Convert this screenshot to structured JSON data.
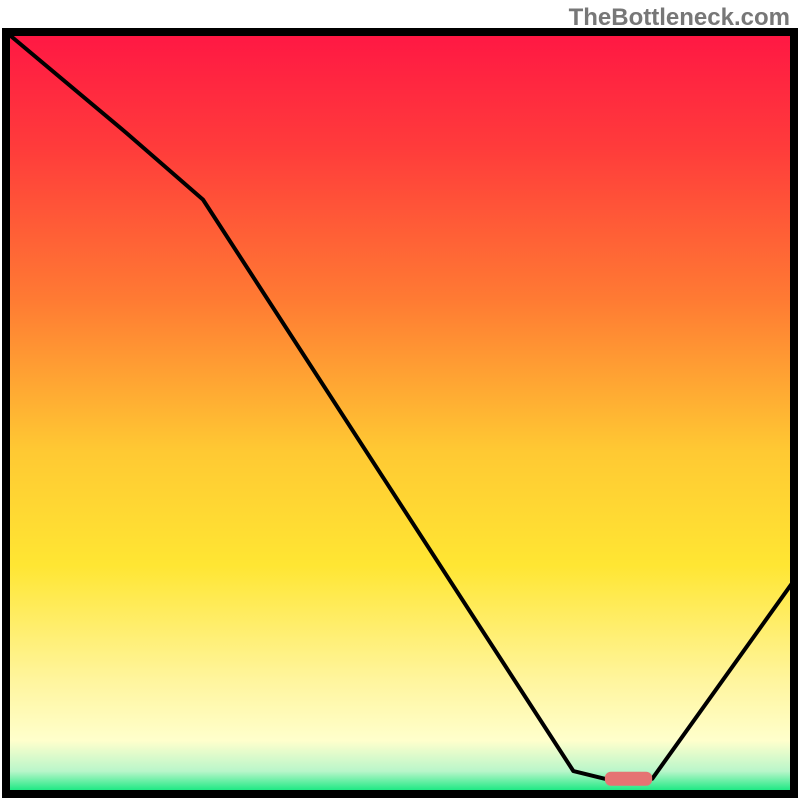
{
  "watermark": "TheBottleneck.com",
  "chart_data": {
    "type": "line",
    "title": "",
    "xlabel": "",
    "ylabel": "",
    "xlim": [
      0,
      100
    ],
    "ylim": [
      0,
      100
    ],
    "series": [
      {
        "name": "curve",
        "x": [
          0,
          15,
          25,
          72,
          76,
          82,
          100
        ],
        "values": [
          100,
          87,
          78,
          3,
          2,
          2,
          28
        ]
      }
    ],
    "marker": {
      "x_start": 76,
      "x_end": 82,
      "y": 2
    },
    "gradient_stops": [
      {
        "offset": 0.0,
        "color": "#ff1744"
      },
      {
        "offset": 0.15,
        "color": "#ff3b3b"
      },
      {
        "offset": 0.35,
        "color": "#ff7a33"
      },
      {
        "offset": 0.55,
        "color": "#ffc933"
      },
      {
        "offset": 0.7,
        "color": "#ffe633"
      },
      {
        "offset": 0.85,
        "color": "#fff59d"
      },
      {
        "offset": 0.93,
        "color": "#ffffcc"
      },
      {
        "offset": 0.97,
        "color": "#b9f6ca"
      },
      {
        "offset": 1.0,
        "color": "#00e676"
      }
    ],
    "frame": {
      "stroke": "#000000",
      "width": 8
    },
    "line_style": {
      "stroke": "#000000",
      "width": 4
    },
    "marker_style": {
      "fill": "#e57373",
      "rx": 6,
      "height": 14
    }
  }
}
